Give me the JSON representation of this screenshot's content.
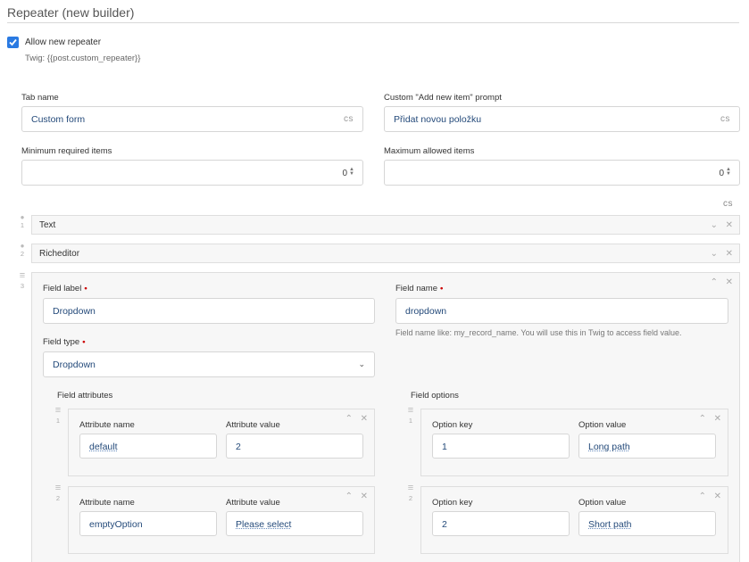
{
  "section": {
    "title": "Repeater (new builder)"
  },
  "allow": {
    "label": "Allow new repeater",
    "twig": "Twig: {{post.custom_repeater}}"
  },
  "fields": {
    "tab_name": {
      "label": "Tab name",
      "value": "Custom form",
      "lang": "cs"
    },
    "add_prompt": {
      "label": "Custom \"Add new item\" prompt",
      "value": "Přidat novou položku",
      "lang": "cs"
    },
    "min_items": {
      "label": "Minimum required items",
      "value": "0"
    },
    "max_items": {
      "label": "Maximum allowed items",
      "value": "0"
    },
    "lang_switch": "cs"
  },
  "items": [
    {
      "index": "1",
      "title": "Text"
    },
    {
      "index": "2",
      "title": "Richeditor"
    }
  ],
  "expanded": {
    "index": "3",
    "field_label": {
      "label": "Field label",
      "value": "Dropdown"
    },
    "field_name": {
      "label": "Field name",
      "value": "dropdown",
      "help": "Field name like: my_record_name. You will use this in Twig to access field value."
    },
    "field_type": {
      "label": "Field type",
      "value": "Dropdown"
    },
    "attributes": {
      "title": "Field attributes",
      "name_label": "Attribute name",
      "value_label": "Attribute value",
      "rows": [
        {
          "index": "1",
          "name": "default",
          "value": "2"
        },
        {
          "index": "2",
          "name": "emptyOption",
          "value": "Please select"
        }
      ]
    },
    "options": {
      "title": "Field options",
      "key_label": "Option key",
      "value_label": "Option value",
      "rows": [
        {
          "index": "1",
          "key": "1",
          "value": "Long path"
        },
        {
          "index": "2",
          "key": "2",
          "value": "Short path"
        }
      ]
    }
  }
}
